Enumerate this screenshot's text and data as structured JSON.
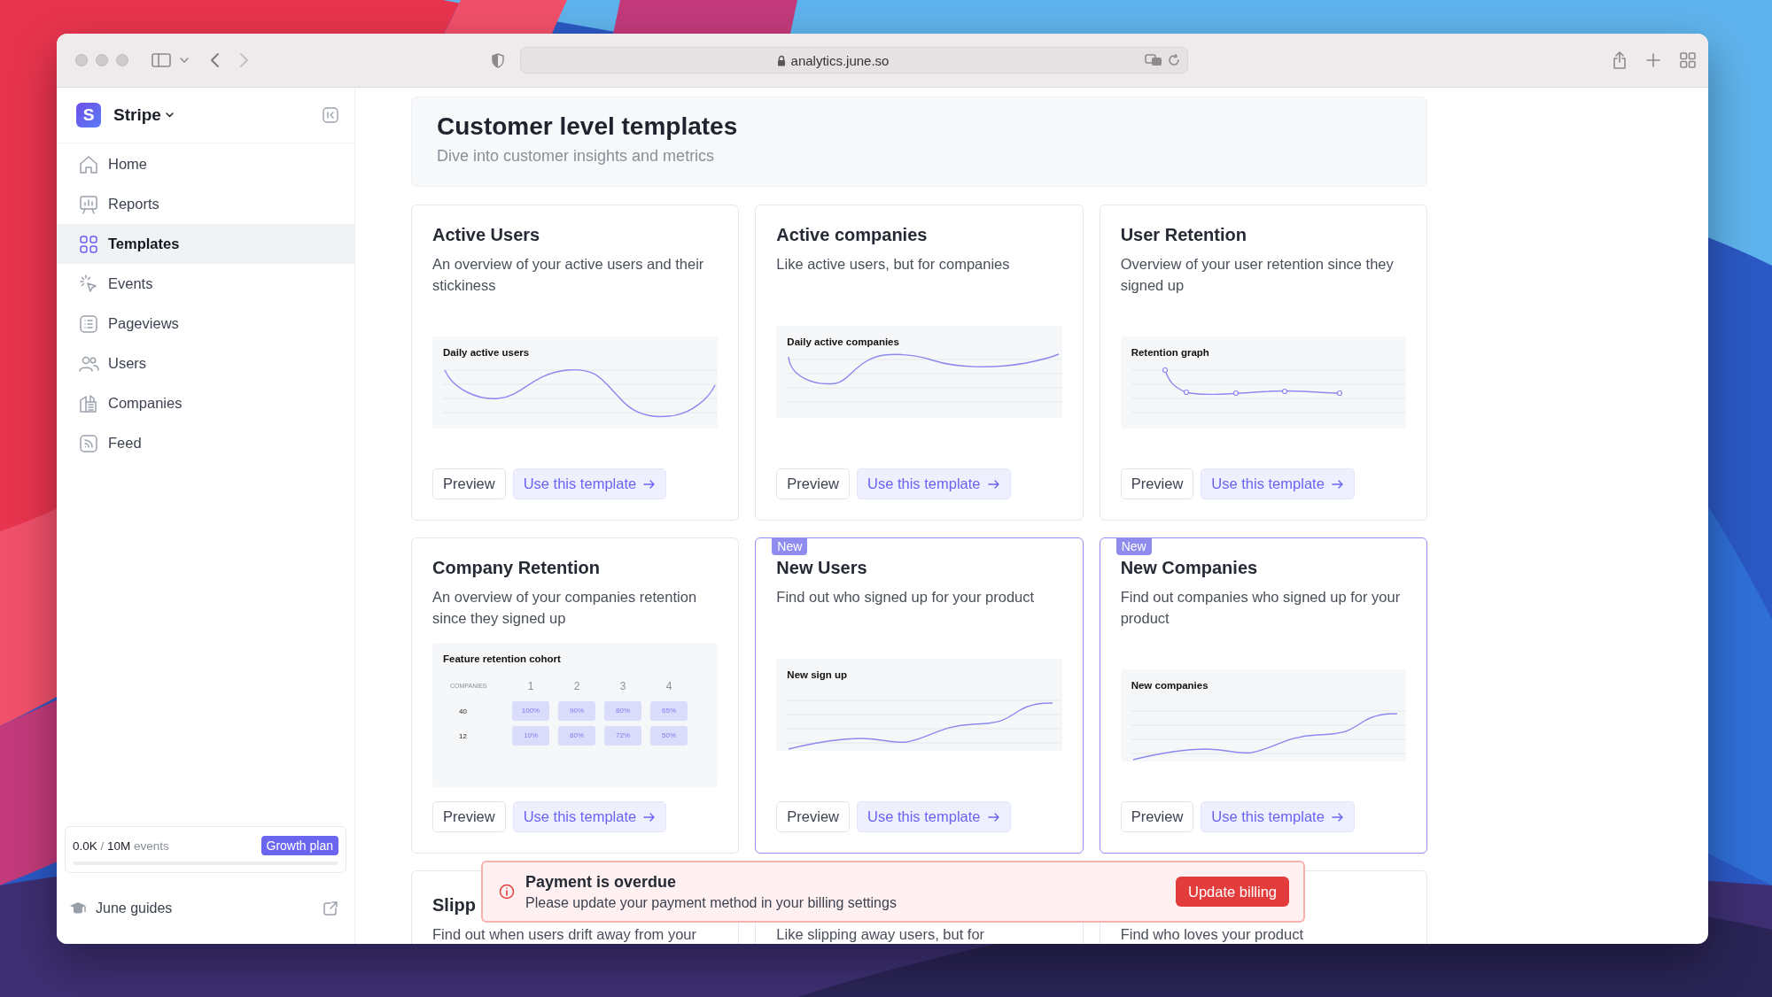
{
  "browser": {
    "url": "analytics.june.so"
  },
  "sidebar": {
    "logo": "S",
    "workspace": "Stripe",
    "items": [
      {
        "label": "Home",
        "selected": false
      },
      {
        "label": "Reports",
        "selected": false
      },
      {
        "label": "Templates",
        "selected": true
      },
      {
        "label": "Events",
        "selected": false
      },
      {
        "label": "Pageviews",
        "selected": false
      },
      {
        "label": "Users",
        "selected": false
      },
      {
        "label": "Companies",
        "selected": false
      },
      {
        "label": "Feed",
        "selected": false
      }
    ],
    "usage": {
      "used": "0.0K",
      "separator": "/",
      "total": "10M",
      "unit": "events",
      "level": 0,
      "plan": "Growth plan"
    },
    "guides": "June guides"
  },
  "header": {
    "title": "Customer level templates",
    "subtitle": "Dive into customer insights and metrics"
  },
  "cards": [
    {
      "title": "Active Users",
      "description": "An overview of your active users and their stickiness",
      "new": false,
      "preview": {
        "kind": "wave",
        "title": "Daily active users"
      },
      "buttons": [
        {
          "kind": "secondary",
          "label": "Preview"
        },
        {
          "kind": "primary",
          "label": "Use this template"
        }
      ]
    },
    {
      "title": "Active companies",
      "description": "Like active users, but for companies",
      "new": false,
      "preview": {
        "kind": "rise",
        "title": "Daily active companies"
      },
      "buttons": [
        {
          "kind": "secondary",
          "label": "Preview"
        },
        {
          "kind": "primary",
          "label": "Use this template"
        }
      ]
    },
    {
      "title": "User Retention",
      "description": "Overview of your user retention since they signed up",
      "new": false,
      "preview": {
        "kind": "retention",
        "title": "Retention graph"
      },
      "buttons": [
        {
          "kind": "secondary",
          "label": "Preview"
        },
        {
          "kind": "primary",
          "label": "Use this template"
        }
      ]
    },
    {
      "title": "Company Retention",
      "description": "An overview of your companies retention since they signed up",
      "new": false,
      "preview": {
        "kind": "cohort",
        "title": "Feature retention cohort",
        "columns": [
          "COMPANIES",
          "1",
          "2",
          "3",
          "4"
        ],
        "rows": [
          {
            "cells": [
              "40",
              "100%",
              "90%",
              "80%",
              "65%"
            ]
          },
          {
            "cells": [
              "12",
              "10%",
              "80%",
              "72%",
              "50%"
            ]
          }
        ]
      },
      "buttons": [
        {
          "kind": "secondary",
          "label": "Preview"
        },
        {
          "kind": "primary",
          "label": "Use this template"
        }
      ]
    },
    {
      "title": "New Users",
      "description": "Find out who signed up for your product",
      "new": true,
      "badge": "New",
      "preview": {
        "kind": "growth",
        "title": "New sign up"
      },
      "buttons": [
        {
          "kind": "secondary",
          "label": "Preview"
        },
        {
          "kind": "primary",
          "label": "Use this template"
        }
      ]
    },
    {
      "title": "New Companies",
      "description": "Find out companies who signed up for your product",
      "new": true,
      "badge": "New",
      "preview": {
        "kind": "growth",
        "title": "New companies"
      },
      "buttons": [
        {
          "kind": "secondary",
          "label": "Preview"
        },
        {
          "kind": "primary",
          "label": "Use this template"
        }
      ]
    },
    {
      "title": "Slipp",
      "description": "Find out when users drift away from your",
      "new": false
    },
    {
      "description": "Like slipping away users, but for",
      "new": false
    },
    {
      "description": "Find who loves your product",
      "new": false
    }
  ],
  "banner": {
    "title": "Payment is overdue",
    "message": "Please update your payment method in your billing settings",
    "button": "Update billing"
  }
}
